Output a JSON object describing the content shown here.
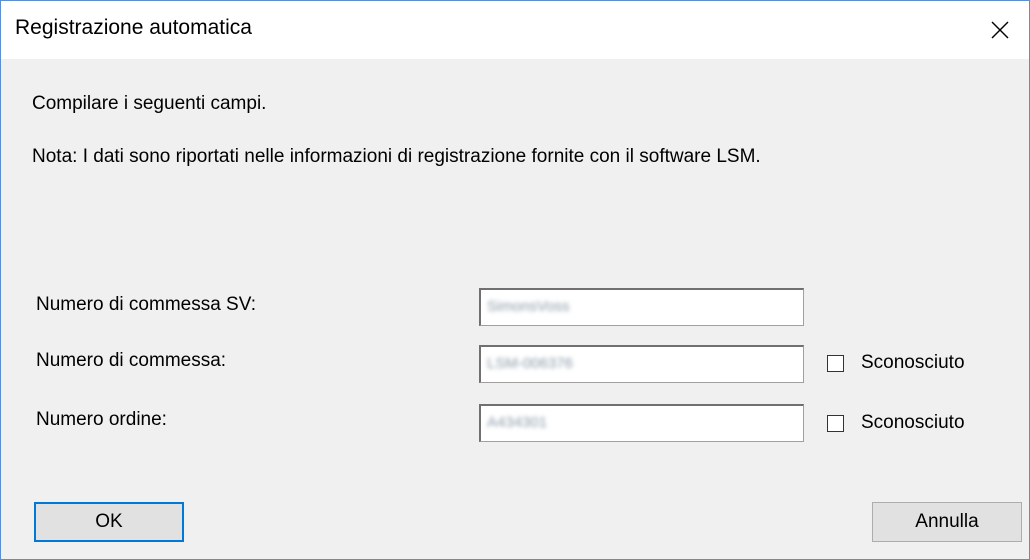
{
  "dialog": {
    "title": "Registrazione automatica",
    "instruction": "Compilare i seguenti campi.",
    "note": "Nota: I dati sono riportati nelle informazioni di registrazione fornite con il software LSM."
  },
  "fields": [
    {
      "label": "Numero di commessa SV:",
      "value": "SimonsVoss",
      "has_unknown_checkbox": false
    },
    {
      "label": "Numero di commessa:",
      "value": "LSM-006376",
      "has_unknown_checkbox": true,
      "unknown_label": "Sconosciuto",
      "unknown_checked": false
    },
    {
      "label": "Numero ordine:",
      "value": "A434301",
      "has_unknown_checkbox": true,
      "unknown_label": "Sconosciuto",
      "unknown_checked": false
    }
  ],
  "buttons": {
    "ok_label": "OK",
    "cancel_label": "Annulla"
  },
  "icons": {
    "close": "close-icon"
  },
  "colors": {
    "window_border": "#5b8fd1",
    "dialog_background": "#f0f0f0",
    "default_button_border": "#0078d7"
  }
}
